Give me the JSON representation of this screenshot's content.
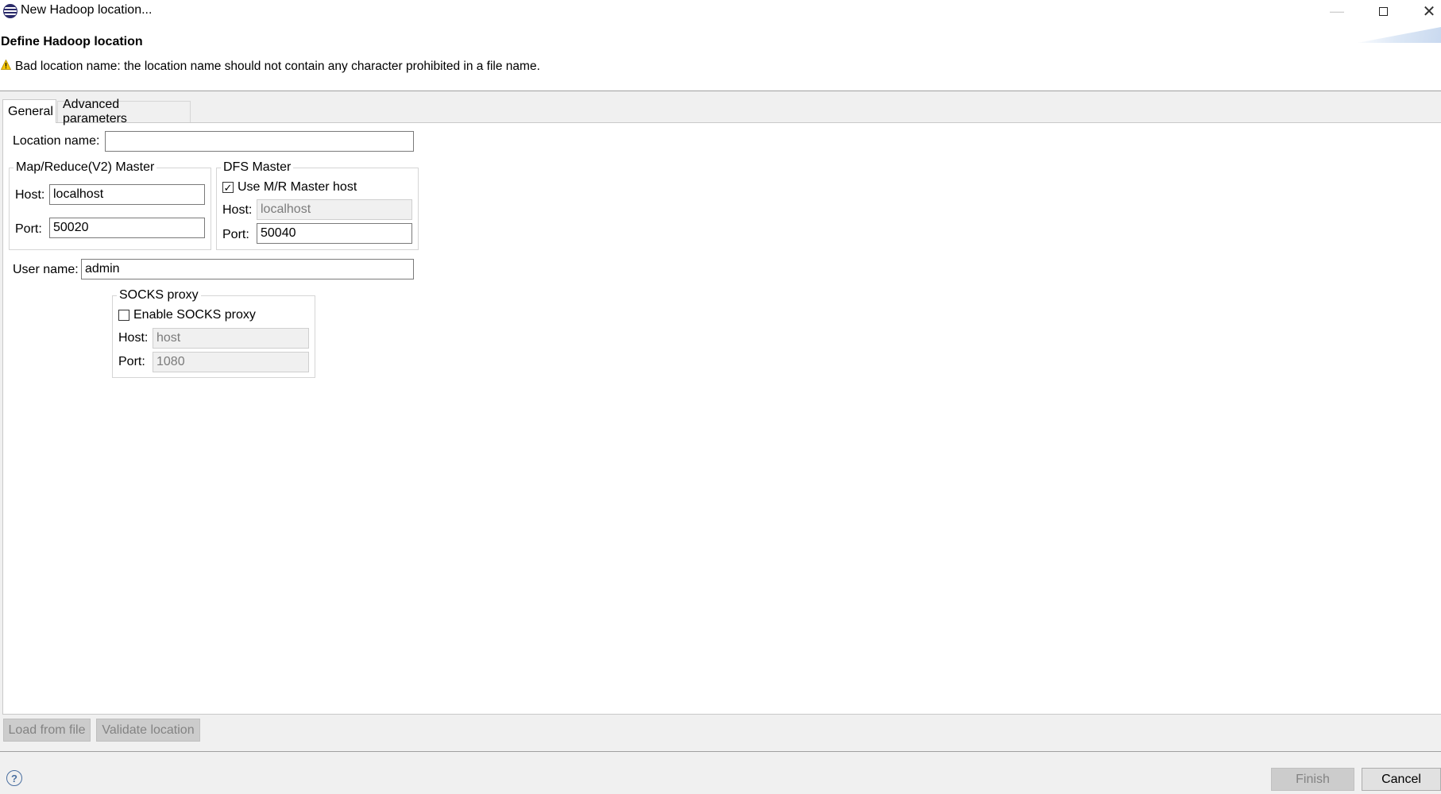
{
  "window": {
    "title": "New Hadoop location...",
    "controls": {
      "minimize": "—",
      "maximize": "",
      "close": "✕"
    }
  },
  "header": {
    "title": "Define Hadoop location",
    "warning": "Bad location name: the location name should not contain any character prohibited in a file name."
  },
  "tabs": [
    {
      "label": "General",
      "selected": true
    },
    {
      "label": "Advanced parameters",
      "selected": false
    }
  ],
  "general": {
    "location_name": {
      "label": "Location name:",
      "value": ""
    },
    "mr_master": {
      "title": "Map/Reduce(V2) Master",
      "host_label": "Host:",
      "host": "localhost",
      "port_label": "Port:",
      "port": "50020"
    },
    "dfs_master": {
      "title": "DFS Master",
      "use_mr_host_label": "Use M/R Master host",
      "use_mr_host_checked": true,
      "host_label": "Host:",
      "host": "localhost",
      "port_label": "Port:",
      "port": "50040"
    },
    "user_name": {
      "label": "User name:",
      "value": "admin"
    },
    "socks_proxy": {
      "title": "SOCKS proxy",
      "enable_label": "Enable SOCKS proxy",
      "enabled": false,
      "host_label": "Host:",
      "host": "host",
      "port_label": "Port:",
      "port": "1080"
    }
  },
  "actions": {
    "load_from_file": "Load from file",
    "validate_location": "Validate location",
    "finish": "Finish",
    "cancel": "Cancel",
    "help": "?"
  },
  "colors": {
    "window_bg": "#f0f0f0",
    "disabled_text": "#838383",
    "help_icon": "#4a6fa0"
  }
}
